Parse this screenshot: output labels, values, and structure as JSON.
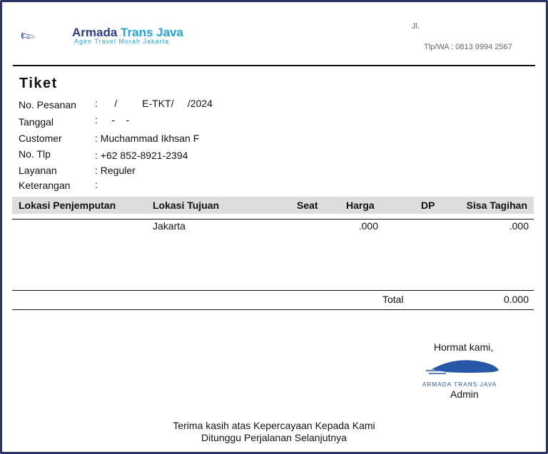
{
  "header": {
    "brand_part1": "Armada",
    "brand_part2": "Trans Java",
    "tagline": "Agen Travel Murah Jakarta",
    "address": "Jl.",
    "phone": "Tlp/WA : 0813 9994 2567"
  },
  "title": "Tiket",
  "info": [
    {
      "label": "No. Pesanan",
      "value": ":      /         E-TKT/     /2024"
    },
    {
      "label": "Tanggal",
      "value": ":     -    -"
    },
    {
      "label": "Customer",
      "value": ": Muchammad Ikhsan F"
    },
    {
      "label": "No. Tlp",
      "value": ": +62 852-8921-2394"
    },
    {
      "label": "Layanan",
      "value": ": Reguler"
    },
    {
      "label": "Keterangan",
      "value": ":"
    }
  ],
  "table": {
    "headers": [
      "Lokasi Penjemputan",
      "Lokasi Tujuan",
      "Seat",
      "Harga",
      "DP",
      "Sisa Tagihan"
    ],
    "rows": [
      {
        "pickup": "",
        "destination": "Jakarta",
        "seat": "",
        "price": ".000",
        "dp": "",
        "remaining": ".000"
      }
    ],
    "total_label": "Total",
    "total_value": "0.000"
  },
  "signature": {
    "greeting": "Hormat kami,",
    "stamp_text": "ARMADA TRANS JAVA",
    "name": "Admin"
  },
  "footer": {
    "line1": "Terima kasih atas Kepercayaan Kepada Kami",
    "line2": "Ditunggu Perjalanan Selanjutnya"
  }
}
